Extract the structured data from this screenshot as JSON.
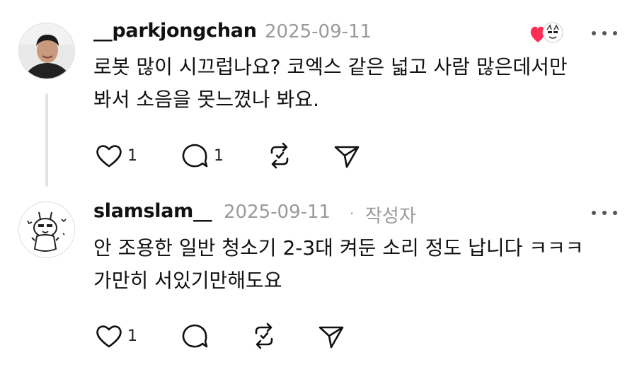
{
  "comments": [
    {
      "username": "__parkjongchan",
      "date": "2025-09-11",
      "text_lines": [
        "로봇 많이 시끄럽나요? 코엑스 같은 넓고 사람 많은데서만",
        "봐서 소음을 못느꼈나 봐요."
      ],
      "likes": "1",
      "replies": "1",
      "icons": {
        "like": "heart-outline-icon",
        "reply": "comment-bubble-icon",
        "repost": "repost-icon",
        "share": "send-icon",
        "more": "more-options-icon"
      }
    },
    {
      "username": "slamslam__",
      "date": "2025-09-11",
      "separator": "·",
      "author_tag": "작성자",
      "text_lines": [
        "안 조용한 일반 청소기 2-3대 켜둔 소리 정도 납니다 ㅋㅋㅋ",
        "가만히 서있기만해도요"
      ],
      "likes": "1",
      "icons": {
        "like": "heart-outline-icon",
        "reply": "comment-bubble-icon",
        "repost": "repost-icon",
        "share": "send-icon",
        "more": "more-options-icon"
      }
    }
  ],
  "reaction_badge": {
    "heart_color": "#ff2d55",
    "icon": "liked-by-author-icon"
  }
}
